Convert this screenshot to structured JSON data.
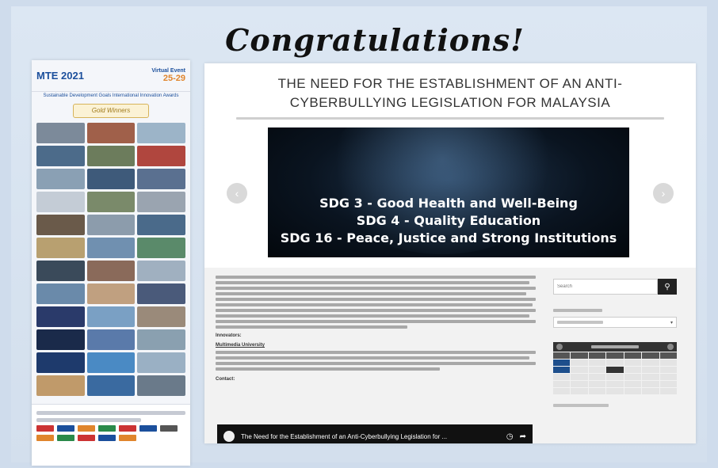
{
  "heading": "Congratulations!",
  "poster": {
    "logo": "MTE 2021",
    "dates": "25-29",
    "dates_sub": "Virtual Event",
    "subtitle": "Sustainable Development Goals International Innovation Awards",
    "award": "Gold Winners",
    "thumb_colors": [
      "#7c8a9a",
      "#a0604a",
      "#9cb4c8",
      "#4c6b8a",
      "#6c7c5c",
      "#b0463e",
      "#8aa0b4",
      "#3e5a7a",
      "#5a7090",
      "#c4ccd6",
      "#7a8a6a",
      "#9aa4b0",
      "#6a5a4a",
      "#8c9cac",
      "#4a6a8a",
      "#b8a070",
      "#7090b0",
      "#5a8a6a",
      "#3a4a5a",
      "#8a6a5a",
      "#a0b0c0",
      "#6a8aaa",
      "#c0a080",
      "#4a5a7a",
      "#2a3a6a",
      "#7aa0c4",
      "#9a8a7a",
      "#1a2a4a",
      "#5a7aaa",
      "#8aa0b0",
      "#1e3a6c",
      "#4a8ac4",
      "#9ab0c4",
      "#c09a6a",
      "#3a6aa0",
      "#6a7a8a"
    ],
    "logo_colors": [
      "#c33",
      "#1b4f9c",
      "#e0852c",
      "#2a8a4a",
      "#c33",
      "#1b4f9c",
      "#555",
      "#e0852c",
      "#2a8a4a",
      "#c33",
      "#1b4f9c",
      "#e0852c"
    ]
  },
  "article": {
    "title": "THE NEED FOR THE ESTABLISHMENT OF AN ANTI-CYBERBULLYING LEGISLATION FOR MALAYSIA",
    "slide": {
      "line1": "SDG 3 - Good Health and Well-Being",
      "line2": "SDG 4 - Quality Education",
      "line3": "SDG 16 - Peace, Justice and Strong Institutions"
    },
    "label_innovators": "Innovators:",
    "institution": "Multimedia University",
    "contact_label": "Contact:",
    "video_title": "The Need for the Establishment of an Anti-Cyberbullying Legislation for ..."
  },
  "sidebar": {
    "search_placeholder": "Search"
  }
}
